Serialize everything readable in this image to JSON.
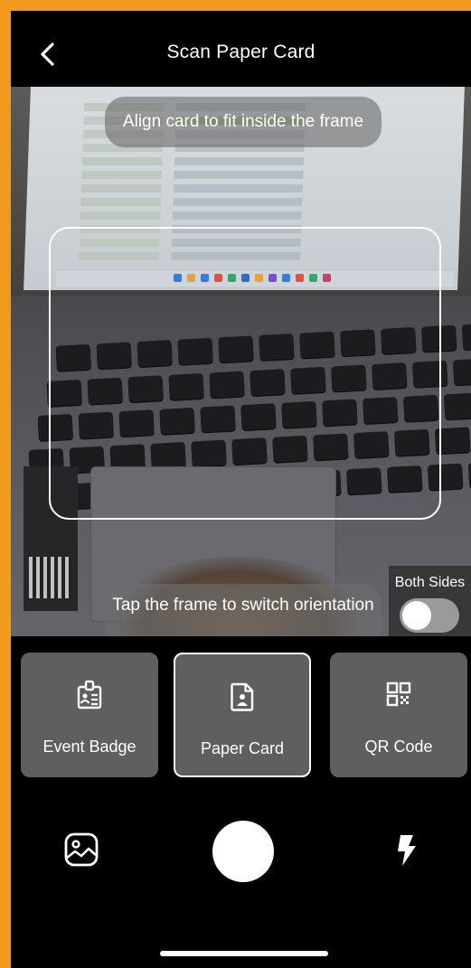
{
  "header": {
    "title": "Scan Paper Card",
    "back_icon": "chevron-left-icon"
  },
  "camera": {
    "align_hint": "Align card to fit inside the frame",
    "tap_hint": "Tap the frame to switch orientation",
    "both_sides_label": "Both Sides",
    "both_sides_enabled": false
  },
  "modes": [
    {
      "label": "Event Badge",
      "icon": "badge-icon",
      "selected": false
    },
    {
      "label": "Paper Card",
      "icon": "paper-card-icon",
      "selected": true
    },
    {
      "label": "QR Code",
      "icon": "qr-code-icon",
      "selected": false
    }
  ],
  "controls": {
    "gallery_icon": "gallery-icon",
    "shutter": "shutter-button",
    "flash_icon": "flash-icon"
  },
  "colors": {
    "frame_border": "#F29A1E",
    "background": "#000000",
    "mode_tile": "#5F5F5F",
    "toggle_off": "#9A9A9A"
  }
}
